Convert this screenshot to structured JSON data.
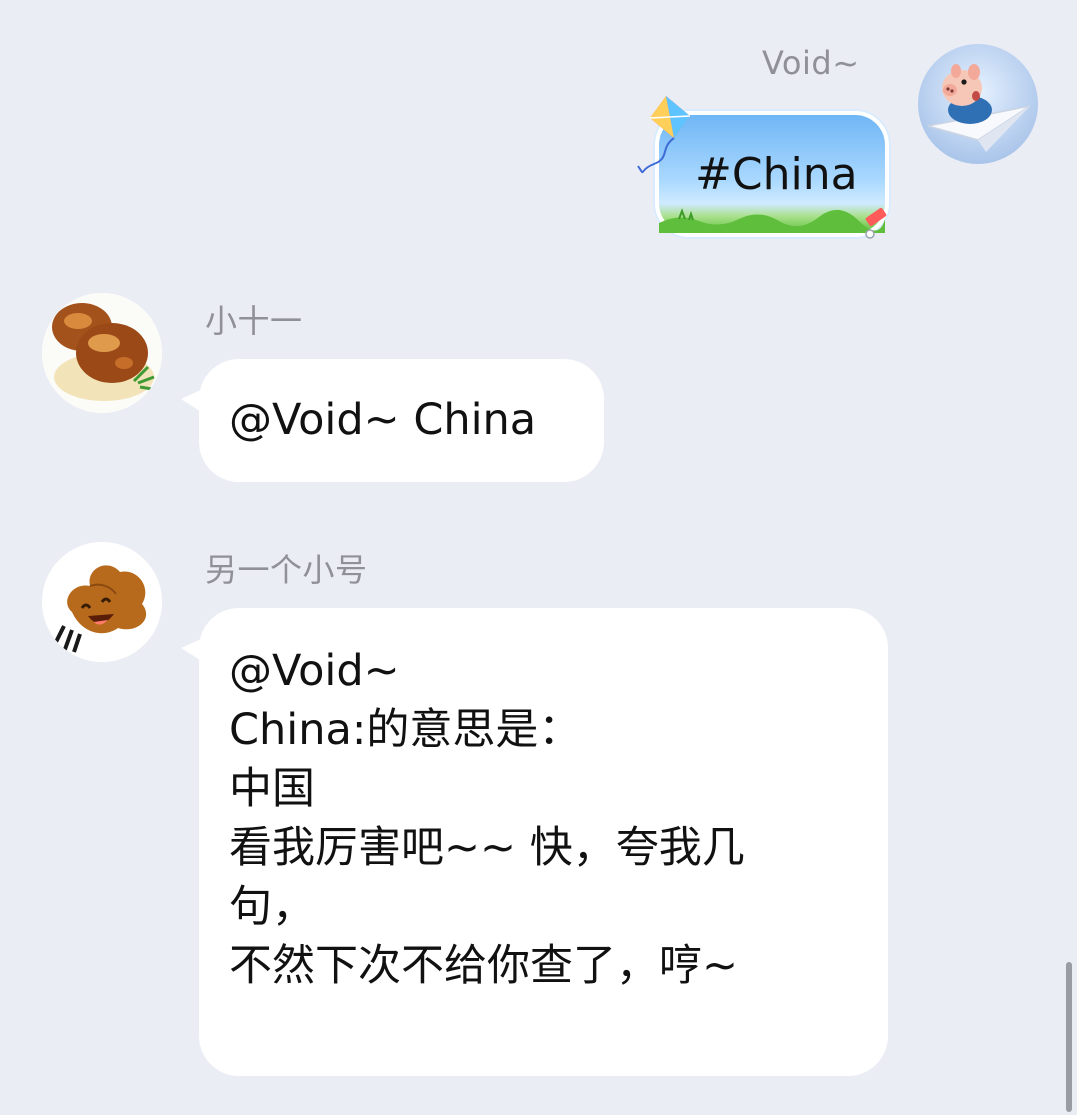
{
  "messages": [
    {
      "sender": "Void~",
      "text": "#China",
      "side": "right"
    },
    {
      "sender": "小十一",
      "text": "@Void~ China",
      "side": "left"
    },
    {
      "sender": "另一个小号",
      "side": "left",
      "lines": [
        "@Void~",
        "China:的意思是：",
        "中国",
        "看我厉害吧~~ 快，夸我几",
        "句，",
        "不然下次不给你查了，哼~"
      ]
    }
  ],
  "avatars": {
    "void": "pig-on-paper-plane-avatar",
    "xiaoshiyi": "braised-meatballs-avatar",
    "alt_account": "smiling-poop-avatar"
  },
  "colors": {
    "background": "#ebedf5",
    "sender_name": "#8f9196",
    "bubble_white": "#ffffff",
    "bubble_blue": "#8cc7fb",
    "grass": "#5fbf3c"
  }
}
